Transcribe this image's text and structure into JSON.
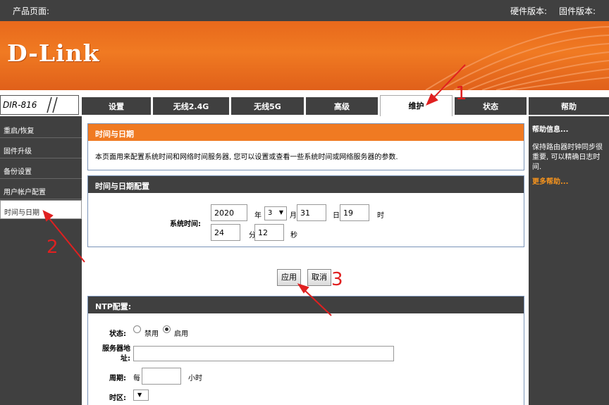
{
  "topbar": {
    "product_page": "产品页面:",
    "hardware_version": "硬件版本:",
    "firmware_version": "固件版本:"
  },
  "brand": {
    "logo": "D-Link",
    "model": "DIR-816"
  },
  "tabs": [
    {
      "label": "设置"
    },
    {
      "label": "无线2.4G"
    },
    {
      "label": "无线5G"
    },
    {
      "label": "高级"
    },
    {
      "label": "维护"
    },
    {
      "label": "状态"
    },
    {
      "label": "帮助"
    }
  ],
  "sidebar": {
    "items": [
      {
        "label": "重启/恢复"
      },
      {
        "label": "固件升级"
      },
      {
        "label": "备份设置"
      },
      {
        "label": "用户帐户配置"
      },
      {
        "label": "时间与日期"
      }
    ]
  },
  "intro": {
    "title": "时间与日期",
    "text": "本页面用来配置系统时间和网络时间服务器, 您可以设置或查看一些系统时间或网络服务器的参数."
  },
  "time_config": {
    "title": "时间与日期配置",
    "system_time_label": "系统时间:",
    "year_value": "2020",
    "year_unit": "年",
    "month_value": "3",
    "month_unit": "月",
    "day_value": "31",
    "day_unit": "日",
    "hour_value": "19",
    "hour_unit": "时",
    "minute_value": "24",
    "minute_unit": "分",
    "second_value": "12",
    "second_unit": "秒"
  },
  "actions": {
    "apply": "应用",
    "cancel": "取消"
  },
  "ntp": {
    "title": "NTP配置:",
    "status_label": "状态:",
    "disable_label": "禁用",
    "enable_label": "启用",
    "server_label": "服务器地址:",
    "server_value": "",
    "period_label": "周期:",
    "period_prefix": "每",
    "period_value": "",
    "period_unit": "小时",
    "timezone_label": "时区:"
  },
  "help": {
    "title": "帮助信息...",
    "text": "保持路由器时钟同步很重要, 可以精确日志时间.",
    "more": "更多帮助..."
  },
  "annotations": [
    "1",
    "2",
    "3"
  ],
  "colors": {
    "accent": "#f07a22",
    "chrome": "#404040",
    "annotation": "#e02020"
  }
}
